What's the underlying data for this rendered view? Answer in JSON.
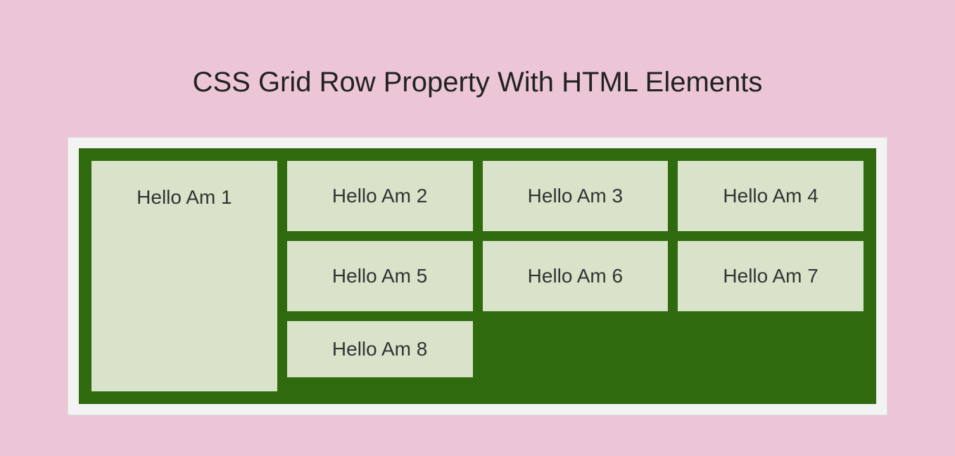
{
  "title": "CSS Grid Row Property With HTML Elements",
  "cells": {
    "item1": "Hello Am 1",
    "item2": "Hello Am 2",
    "item3": "Hello Am 3",
    "item4": "Hello Am 4",
    "item5": "Hello Am 5",
    "item6": "Hello Am 6",
    "item7": "Hello Am 7",
    "item8": "Hello Am 8"
  }
}
